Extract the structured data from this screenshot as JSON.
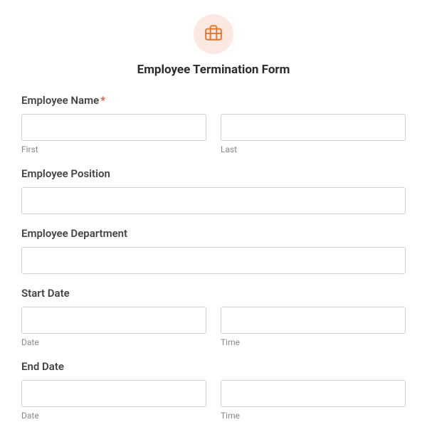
{
  "form": {
    "title": "Employee Termination Form",
    "icon": "briefcase-icon",
    "fields": {
      "employeeName": {
        "label": "Employee Name",
        "required": true,
        "first": {
          "sublabel": "First",
          "value": ""
        },
        "last": {
          "sublabel": "Last",
          "value": ""
        }
      },
      "employeePosition": {
        "label": "Employee Position",
        "value": ""
      },
      "employeeDepartment": {
        "label": "Employee Department",
        "value": ""
      },
      "startDate": {
        "label": "Start Date",
        "date": {
          "sublabel": "Date",
          "value": ""
        },
        "time": {
          "sublabel": "Time",
          "value": ""
        }
      },
      "endDate": {
        "label": "End Date",
        "date": {
          "sublabel": "Date",
          "value": ""
        },
        "time": {
          "sublabel": "Time",
          "value": ""
        }
      }
    }
  }
}
